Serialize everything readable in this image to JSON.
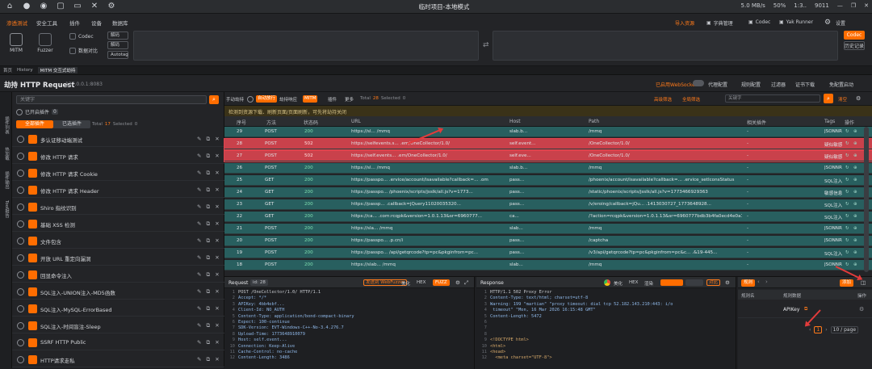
{
  "window": {
    "title": "临时项目-本地模式",
    "right_items": [
      "5.0 MB/s",
      "50%",
      "1:3..",
      "9011"
    ]
  },
  "ribbon": {
    "tabs": [
      "渗透测试",
      "安全工具",
      "插件",
      "设备",
      "数据库"
    ],
    "mitm": "MITM",
    "fuzzer": "Fuzzer",
    "codec": "Codec",
    "compare": "数据对比",
    "codec_mode": "解码",
    "codec_mode2": "解码",
    "autodecode": "Autotag",
    "right_buttons": [
      "导入资源",
      "字典管理",
      "Codec",
      "Yak Runner",
      "",
      "设置"
    ],
    "code_btn": "Codec",
    "history_btn": "历史记录"
  },
  "tabstrip": {
    "items": [
      "首页",
      "History",
      "MITM 交互式劫持"
    ]
  },
  "header": {
    "title": "劫持 HTTP Request",
    "addr": "127.0.0.1:8083",
    "right": [
      "已启用WebSocket",
      "代理配置",
      "规则配置",
      "过滤器",
      "证书下载",
      "免配置启动"
    ]
  },
  "plugins": {
    "search_placeholder": "关键字",
    "tab_installed": "已开启插件",
    "tab_count": "0",
    "btn_all": "全部插件",
    "btn_enabled": "已选插件",
    "total_label": "Total",
    "total": "17",
    "selected_label": "Selected",
    "selected": "0",
    "items": [
      "多认证移动端测试",
      "修改 HTTP 请求",
      "修改 HTTP 请求 Cookie",
      "修改 HTTP 请求 Header",
      "Shiro 指纹识别",
      "基础 XSS 检测",
      "文件包含",
      "开放 URL 重定向漏洞",
      "回显命令注入",
      "SQL注入-UNION注入-MD5函数",
      "SQL注入-MySQL-ErrorBased",
      "SQL注入-时间盲注-Sleep",
      "SSRF HTTP Public",
      "HTTP请求走私"
    ],
    "action_icons": "✎ ⧉ ✕"
  },
  "sidebar": [
    "插件列表",
    "热加载",
    "插件输出",
    "Tool报告"
  ],
  "history": {
    "bar_left": [
      "手动劫持",
      "自动放行",
      "劫持响应",
      "MITM",
      "插件",
      "更多"
    ],
    "total_label": "Total",
    "total": "28",
    "selected_label": "Selected",
    "selected": "0",
    "bar_right": [
      "高级筛选",
      "全局筛选",
      "关键字"
    ],
    "clear": "清空",
    "warning": "检测到资源下载、刷新页面/页面刷新，可先将劫持关闭",
    "columns": [
      "序号",
      "方法",
      "状态码",
      "URL",
      "Host",
      "Path",
      "相关插件",
      "Tags",
      "操作"
    ],
    "rows": [
      {
        "id": "29",
        "method": "POST",
        "status": "200",
        "url": "https://sl... /mmq",
        "host": "slab.b...",
        "path": "/mmq",
        "plugin": "-",
        "tags": "JSONNR",
        "style": "teal"
      },
      {
        "id": "28",
        "method": "POST",
        "status": "502",
        "url": "https://selfevents.s... .em/OneCollector/1.0/",
        "host": "self.event...",
        "path": "/OneCollector/1.0/",
        "plugin": "-",
        "tags": "疑似敏感",
        "style": "red"
      },
      {
        "id": "27",
        "method": "POST",
        "status": "502",
        "url": "https://self.events... .em/OneCollector/1.0/",
        "host": "self.eve...",
        "path": "/OneCollector/1.0/",
        "plugin": "-",
        "tags": "疑似敏感",
        "style": "red"
      },
      {
        "id": "26",
        "method": "POST",
        "status": "200",
        "url": "https://sl... /mmq",
        "host": "slab.b...",
        "path": "/mmq",
        "plugin": "-",
        "tags": "JSONNR",
        "style": "teal"
      },
      {
        "id": "25",
        "method": "GET",
        "status": "200",
        "url": "https://passpo... .ervice/account/isavailable?callback=... .om",
        "host": "pass...",
        "path": "/phoenix/account/isavailable?callback=... .ervice_setIconsStatus",
        "plugin": "-",
        "tags": "SQL注入",
        "style": "teal"
      },
      {
        "id": "24",
        "method": "GET",
        "status": "200",
        "url": "https://passpo... /phoenix/scripts/jsslk/all.js?v=1773...",
        "host": "pass...",
        "path": "/static/phoenix/scripts/jsslk/all.js?v=1773466929363",
        "plugin": "-",
        "tags": "敏感信息",
        "style": "teal"
      },
      {
        "id": "23",
        "method": "GET",
        "status": "200",
        "url": "https://passp... .callback=jQuery11020035320...",
        "host": "pass...",
        "path": "/v/eroing/callback=jQu... .1413030727_1773648928...",
        "plugin": "-",
        "tags": "SQL注入",
        "style": "teal"
      },
      {
        "id": "22",
        "method": "GET",
        "status": "200",
        "url": "https://ca... .com:rcqpk&version=1.0.1.13&sr=6960777...",
        "host": "ca...",
        "path": "/?action=rcqpk&version=1.0.1.13&sr=6960777bdb3b4fa0ecd4e0a17...",
        "plugin": "-",
        "tags": "SQL注入",
        "style": "teal"
      },
      {
        "id": "21",
        "method": "POST",
        "status": "200",
        "url": "https://sla... /mmq",
        "host": "slab...",
        "path": "/mmq",
        "plugin": "-",
        "tags": "JSONNR",
        "style": "teal"
      },
      {
        "id": "20",
        "method": "POST",
        "status": "200",
        "url": "https://passpo... .p.cn/i",
        "host": "pass...",
        "path": "/captcha",
        "plugin": "-",
        "tags": "JSONNR",
        "style": "teal"
      },
      {
        "id": "19",
        "method": "POST",
        "status": "200",
        "url": "https://passpo... /api/getqrcode?tp=pc&pkginfrom=pc...",
        "host": "pass...",
        "path": "/v3/api/getqrcode?tp=pc&pkginfrom=pc&c... .&19-445...",
        "plugin": "-",
        "tags": "SQL注入",
        "style": "teal"
      },
      {
        "id": "18",
        "method": "POST",
        "status": "200",
        "url": "https://slab... /mmq",
        "host": "slab...",
        "path": "/mmq",
        "plugin": "-",
        "tags": "JSONNR",
        "style": "teal"
      }
    ]
  },
  "request": {
    "label": "Request",
    "id_label": "id:",
    "id": "28",
    "btn_repeater": "发送到 WebFuzzer",
    "beautify": "美化",
    "hex": "HEX",
    "fuzz": "FUZZ",
    "lines": [
      "POST /OneCollector/1.0/ HTTP/1.1",
      "Accept: */*",
      "APIKey: 4bb4ebf...",
      "Client-Id: NO_AUTH",
      "Content-Type: application/bond-compact-binary",
      "Expect: 100-continue",
      "SDK-Version: EVT-Windows-C++-No-3.4.276.7",
      "Upload-Time: 1773648910079",
      "Host: self.event...",
      "Connection: Keep-Alive",
      "Cache-Control: no-cache",
      "Content-Length: 3486"
    ]
  },
  "response": {
    "label": "Response",
    "beautify": "美化",
    "hex": "HEX",
    "render": "渲染",
    "btn_compare": "对比",
    "lines": [
      "HTTP/1.1 502 Proxy Error",
      "Content-Type: text/html; charset=utf-8",
      "Warning: 199 \"martian\" \"proxy timeout: dial tcp 52.182.143.210:443: i/o",
      " timeout\" \"Mon, 16 Mar 2026 16:15:48 GMT\"",
      "Content-Length: 5472",
      "",
      "",
      "",
      "<!DOCTYPE html>",
      "<html>",
      "<head>",
      "  <meta charset=\"UTF-8\">"
    ]
  },
  "rules": {
    "title": "规则",
    "add": "添加",
    "col_name": "规则名",
    "col_data": "规则数据",
    "col_op": "操作",
    "item": "APIKey",
    "page": "1",
    "per_page": "10 / page"
  }
}
